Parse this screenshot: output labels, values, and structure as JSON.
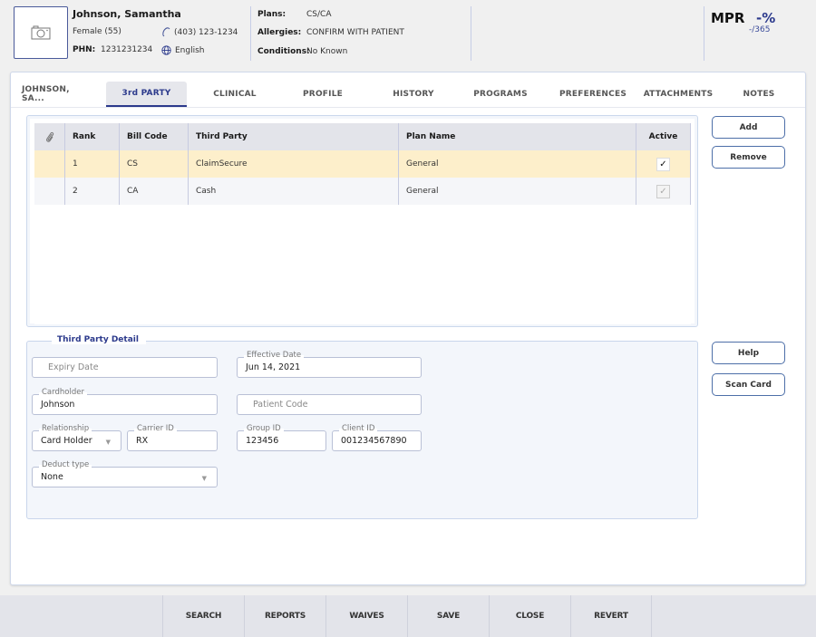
{
  "patient": {
    "name": "Johnson, Samantha",
    "gender_age": "Female (55)",
    "phone": "(403) 123-1234",
    "phn_label": "PHN:",
    "phn": "1231231234",
    "language": "English",
    "plans_label": "Plans:",
    "plans": "CS/CA",
    "allergies_label": "Allergies:",
    "allergies": "CONFIRM WITH PATIENT",
    "conditions_label": "Conditions:",
    "conditions": "No Known"
  },
  "mpr": {
    "label": "MPR",
    "percent": "-%",
    "days": "-/365"
  },
  "tabs": [
    {
      "label": "JOHNSON, SA...",
      "active": false
    },
    {
      "label": "3rd PARTY",
      "active": true
    },
    {
      "label": "CLINICAL",
      "active": false
    },
    {
      "label": "PROFILE",
      "active": false
    },
    {
      "label": "HISTORY",
      "active": false
    },
    {
      "label": "PROGRAMS",
      "active": false
    },
    {
      "label": "PREFERENCES",
      "active": false
    },
    {
      "label": "ATTACHMENTS",
      "active": false
    },
    {
      "label": "NOTES",
      "active": false
    }
  ],
  "grid": {
    "columns": [
      "",
      "Rank",
      "Bill Code",
      "Third Party",
      "Plan Name",
      "Active"
    ],
    "rows": [
      {
        "rank": "1",
        "bill_code": "CS",
        "third_party": "ClaimSecure",
        "plan_name": "General",
        "active": true,
        "selected": true
      },
      {
        "rank": "2",
        "bill_code": "CA",
        "third_party": "Cash",
        "plan_name": "General",
        "active": true,
        "selected": false
      }
    ]
  },
  "side_buttons": {
    "add": "Add",
    "remove": "Remove",
    "help": "Help",
    "scan_card": "Scan Card"
  },
  "detail": {
    "title": "Third Party Detail",
    "expiry_date": {
      "label": "Expiry Date",
      "value": "",
      "placeholder": "Expiry Date"
    },
    "effective_date": {
      "label": "Effective Date",
      "value": "Jun 14, 2021"
    },
    "cardholder": {
      "label": "Cardholder",
      "value": "Johnson"
    },
    "patient_code": {
      "label": "Patient Code",
      "value": "",
      "placeholder": "Patient Code"
    },
    "relationship": {
      "label": "Relationship",
      "value": "Card Holder"
    },
    "carrier_id": {
      "label": "Carrier ID",
      "value": "RX"
    },
    "group_id": {
      "label": "Group ID",
      "value": "123456"
    },
    "client_id": {
      "label": "Client ID",
      "value": "001234567890"
    },
    "deduct_type": {
      "label": "Deduct type",
      "value": "None"
    }
  },
  "toolbar": [
    "SEARCH",
    "REPORTS",
    "WAIVES",
    "SAVE",
    "CLOSE",
    "REVERT"
  ],
  "icons": {
    "check": "✓",
    "dropdown": "▼"
  }
}
